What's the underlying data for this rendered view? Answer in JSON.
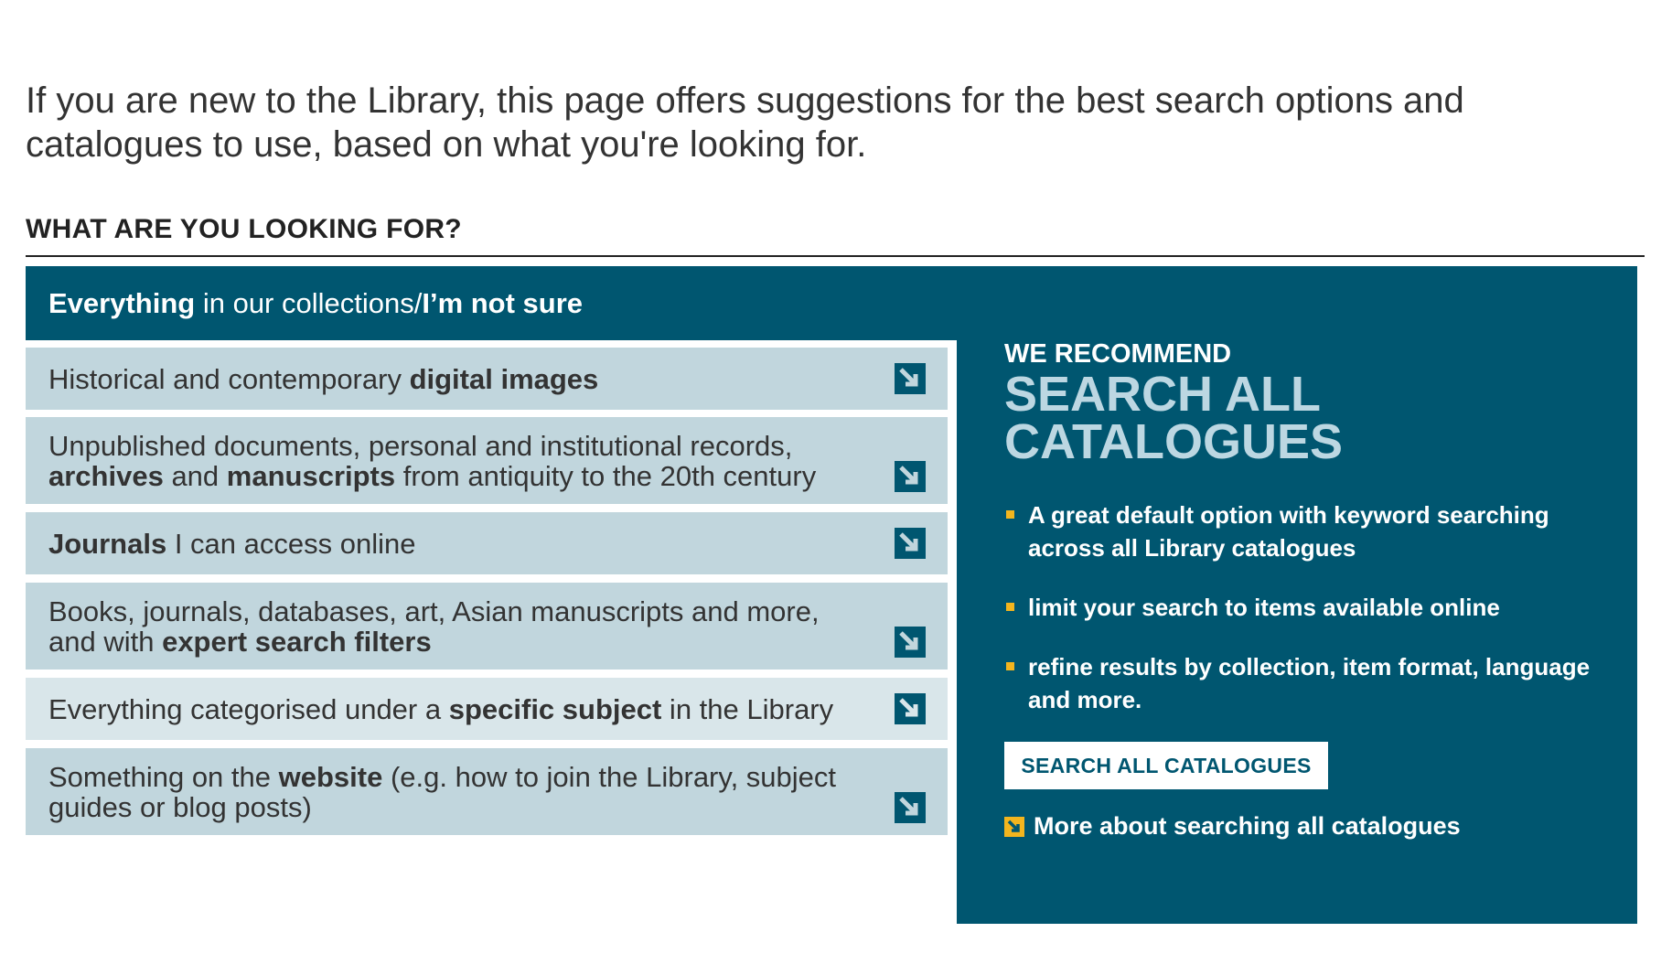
{
  "intro": "If you are new to the Library, this page offers suggestions for the best search options and catalogues to use, based on what you're looking for.",
  "heading": "WHAT ARE YOU LOOKING FOR?",
  "top_option": {
    "bold1": "Everything",
    "text1": " in our collections/",
    "bold2": "I’m not sure"
  },
  "options": [
    {
      "parts": [
        [
          "Historical and contemporary ",
          false
        ],
        [
          "digital images",
          true
        ]
      ]
    },
    {
      "parts": [
        [
          "Unpublished documents, personal and institutional records, ",
          false
        ],
        [
          "archives",
          true
        ],
        [
          " and ",
          false
        ],
        [
          "manuscripts",
          true
        ],
        [
          " from antiquity to the 20th century",
          false
        ]
      ]
    },
    {
      "parts": [
        [
          "Journals",
          true
        ],
        [
          " I can access online",
          false
        ]
      ]
    },
    {
      "parts": [
        [
          "Books, journals, databases, art, Asian manuscripts and more, and with ",
          false
        ],
        [
          "expert search filters",
          true
        ]
      ]
    },
    {
      "parts": [
        [
          "Everything categorised under a ",
          false
        ],
        [
          "specific subject",
          true
        ],
        [
          " in the Library",
          false
        ]
      ]
    },
    {
      "parts": [
        [
          "Something on the ",
          false
        ],
        [
          "website",
          true
        ],
        [
          " (e.g. how to join the Library, subject guides or blog posts)",
          false
        ]
      ]
    }
  ],
  "recommend": {
    "kicker": "WE RECOMMEND",
    "title": "SEARCH ALL CATALOGUES",
    "bullets": [
      "A great default option with keyword searching across all Library catalogues",
      "limit your search to items available online",
      "refine results by collection, item format, language and more."
    ],
    "button": "SEARCH ALL CATALOGUES",
    "more_link": "More about searching all catalogues"
  },
  "colors": {
    "panel": "#005670",
    "option_bg": "#c1d6dd",
    "bullet": "#f3b51e"
  }
}
